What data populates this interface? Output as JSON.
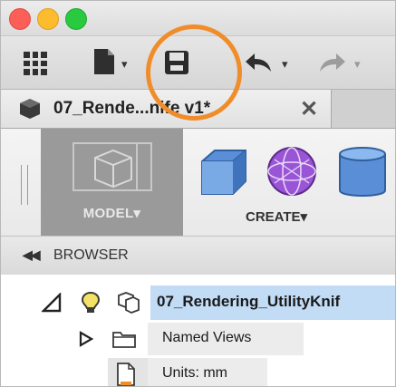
{
  "document": {
    "tab_title": "07_Rende...nife v1*",
    "close_glyph": "✕"
  },
  "toolbar": {
    "icons": [
      "grid-icon",
      "file-icon",
      "save-icon",
      "undo-icon",
      "redo-icon"
    ],
    "caret_glyph": "▾"
  },
  "ribbon": {
    "workspace_label": "MODEL▾",
    "create_label": "CREATE▾"
  },
  "browser": {
    "collapse_glyph": "◀◀",
    "label": "BROWSER",
    "root_name": "07_Rendering_UtilityKnif",
    "items": [
      {
        "label": "Named Views"
      },
      {
        "label": "Units: mm"
      }
    ]
  },
  "colors": {
    "highlight": "#f08d2a",
    "selection": "#c2dcf6"
  }
}
